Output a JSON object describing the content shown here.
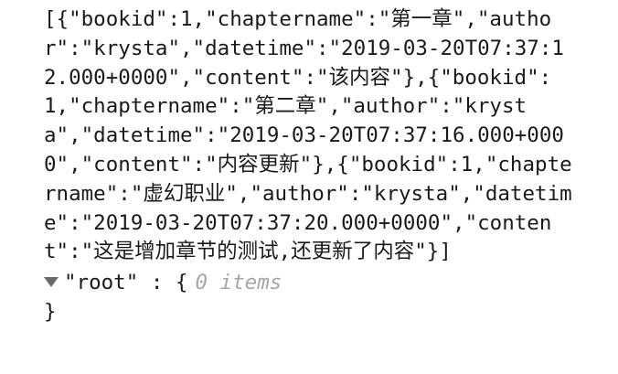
{
  "raw_text": "[{\"bookid\":1,\"chaptername\":\"第一章\",\"author\":\"krysta\",\"datetime\":\"2019-03-20T07:37:12.000+0000\",\"content\":\"该内容\"},{\"bookid\":1,\"chaptername\":\"第二章\",\"author\":\"krysta\",\"datetime\":\"2019-03-20T07:37:16.000+0000\",\"content\":\"内容更新\"},{\"bookid\":1,\"chaptername\":\"虚幻职业\",\"author\":\"krysta\",\"datetime\":\"2019-03-20T07:37:20.000+0000\",\"content\":\"这是增加章节的测试,还更新了内容\"}]",
  "tree": {
    "toggle_icon": "triangle-down-icon",
    "key": "\"root\"",
    "separator": " : ",
    "open_brace": "{",
    "item_count": "0 items",
    "close_brace": "}"
  },
  "colors": {
    "text": "#1a1a1a",
    "muted": "#a6a6a6",
    "toggle": "#6a6a6a",
    "background": "#ffffff"
  }
}
